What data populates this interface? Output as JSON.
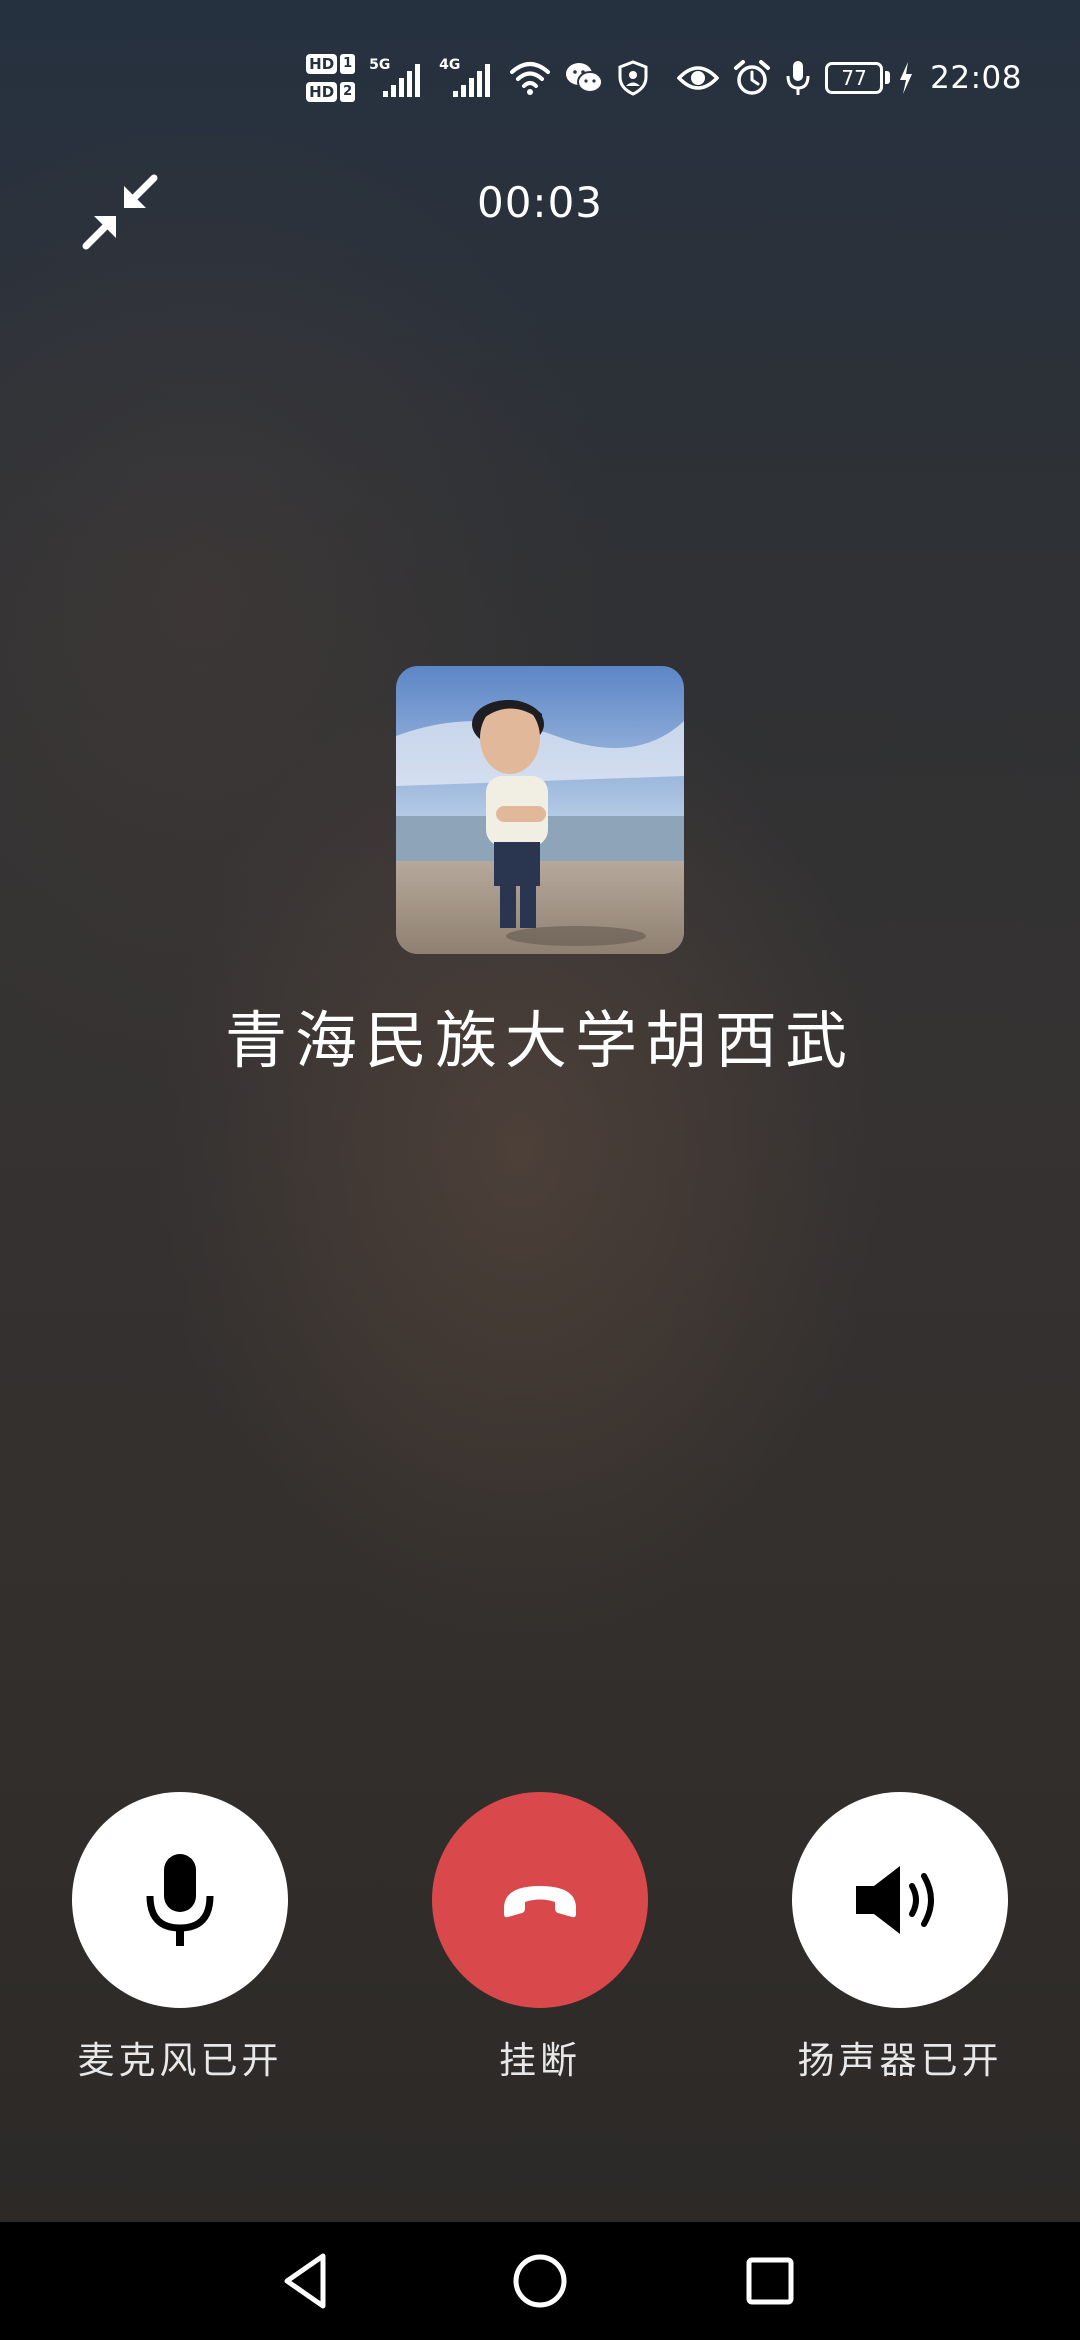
{
  "status_bar": {
    "hd1": "HD",
    "hd1_slot": "1",
    "hd2": "HD",
    "hd2_slot": "2",
    "network1": "5G",
    "network2": "4G",
    "battery_level": "77",
    "time": "22:08",
    "icons": [
      "hd1-icon",
      "hd2-icon",
      "signal-5g-icon",
      "signal-4g-icon",
      "wifi-icon",
      "wechat-icon",
      "shield-icon",
      "eye-icon",
      "alarm-icon",
      "mic-status-icon",
      "battery-icon",
      "charging-icon"
    ]
  },
  "call": {
    "duration": "00:03",
    "caller_name": "青海民族大学胡西武"
  },
  "controls": {
    "mic_label": "麦克风已开",
    "hangup_label": "挂断",
    "speaker_label": "扬声器已开",
    "hangup_color": "#d9484a"
  },
  "nav": {
    "icons": [
      "back-icon",
      "home-icon",
      "recent-apps-icon"
    ]
  }
}
